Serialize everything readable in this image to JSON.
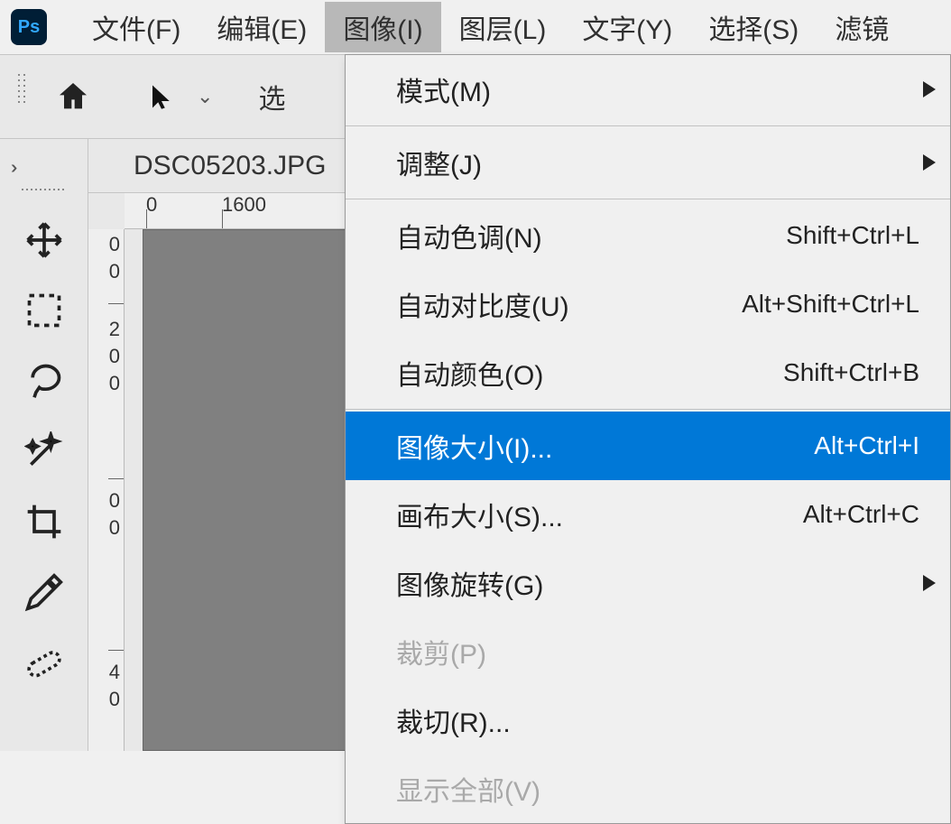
{
  "app": {
    "logo_text": "Ps"
  },
  "menubar": {
    "items": [
      {
        "label": "文件(F)"
      },
      {
        "label": "编辑(E)"
      },
      {
        "label": "图像(I)",
        "active": true
      },
      {
        "label": "图层(L)"
      },
      {
        "label": "文字(Y)"
      },
      {
        "label": "选择(S)"
      },
      {
        "label": "滤镜"
      }
    ]
  },
  "optionsbar": {
    "selected_tool_hint": "选"
  },
  "document": {
    "tab_name": "DSC05203.JPG"
  },
  "ruler_h": {
    "ticks": [
      {
        "pos": 26,
        "label": "0"
      },
      {
        "pos": 110,
        "label": "1600"
      },
      {
        "pos": 248,
        "label": "1"
      }
    ]
  },
  "ruler_v": {
    "ticks": [
      {
        "pos": 6,
        "label": "0"
      },
      {
        "pos": 46,
        "label": "0"
      },
      {
        "pos": 106,
        "label": "2"
      },
      {
        "pos": 146,
        "label": "0"
      },
      {
        "pos": 186,
        "label": "0"
      },
      {
        "pos": 286,
        "label": "0"
      },
      {
        "pos": 326,
        "label": "0"
      },
      {
        "pos": 496,
        "label": "4"
      },
      {
        "pos": 536,
        "label": "0"
      }
    ]
  },
  "dropdown": {
    "items": [
      {
        "label": "模式(M)",
        "submenu": true
      },
      {
        "sep": true
      },
      {
        "label": "调整(J)",
        "submenu": true
      },
      {
        "sep": true
      },
      {
        "label": "自动色调(N)",
        "shortcut": "Shift+Ctrl+L"
      },
      {
        "label": "自动对比度(U)",
        "shortcut": "Alt+Shift+Ctrl+L"
      },
      {
        "label": "自动颜色(O)",
        "shortcut": "Shift+Ctrl+B"
      },
      {
        "sep": true
      },
      {
        "label": "图像大小(I)...",
        "shortcut": "Alt+Ctrl+I",
        "highlight": true
      },
      {
        "label": "画布大小(S)...",
        "shortcut": "Alt+Ctrl+C"
      },
      {
        "label": "图像旋转(G)",
        "submenu": true
      },
      {
        "label": "裁剪(P)",
        "disabled": true
      },
      {
        "label": "裁切(R)..."
      },
      {
        "label": "显示全部(V)",
        "disabled": true
      }
    ]
  },
  "tools": [
    "move",
    "marquee",
    "lasso",
    "wand",
    "crop",
    "eyedropper",
    "heal"
  ]
}
